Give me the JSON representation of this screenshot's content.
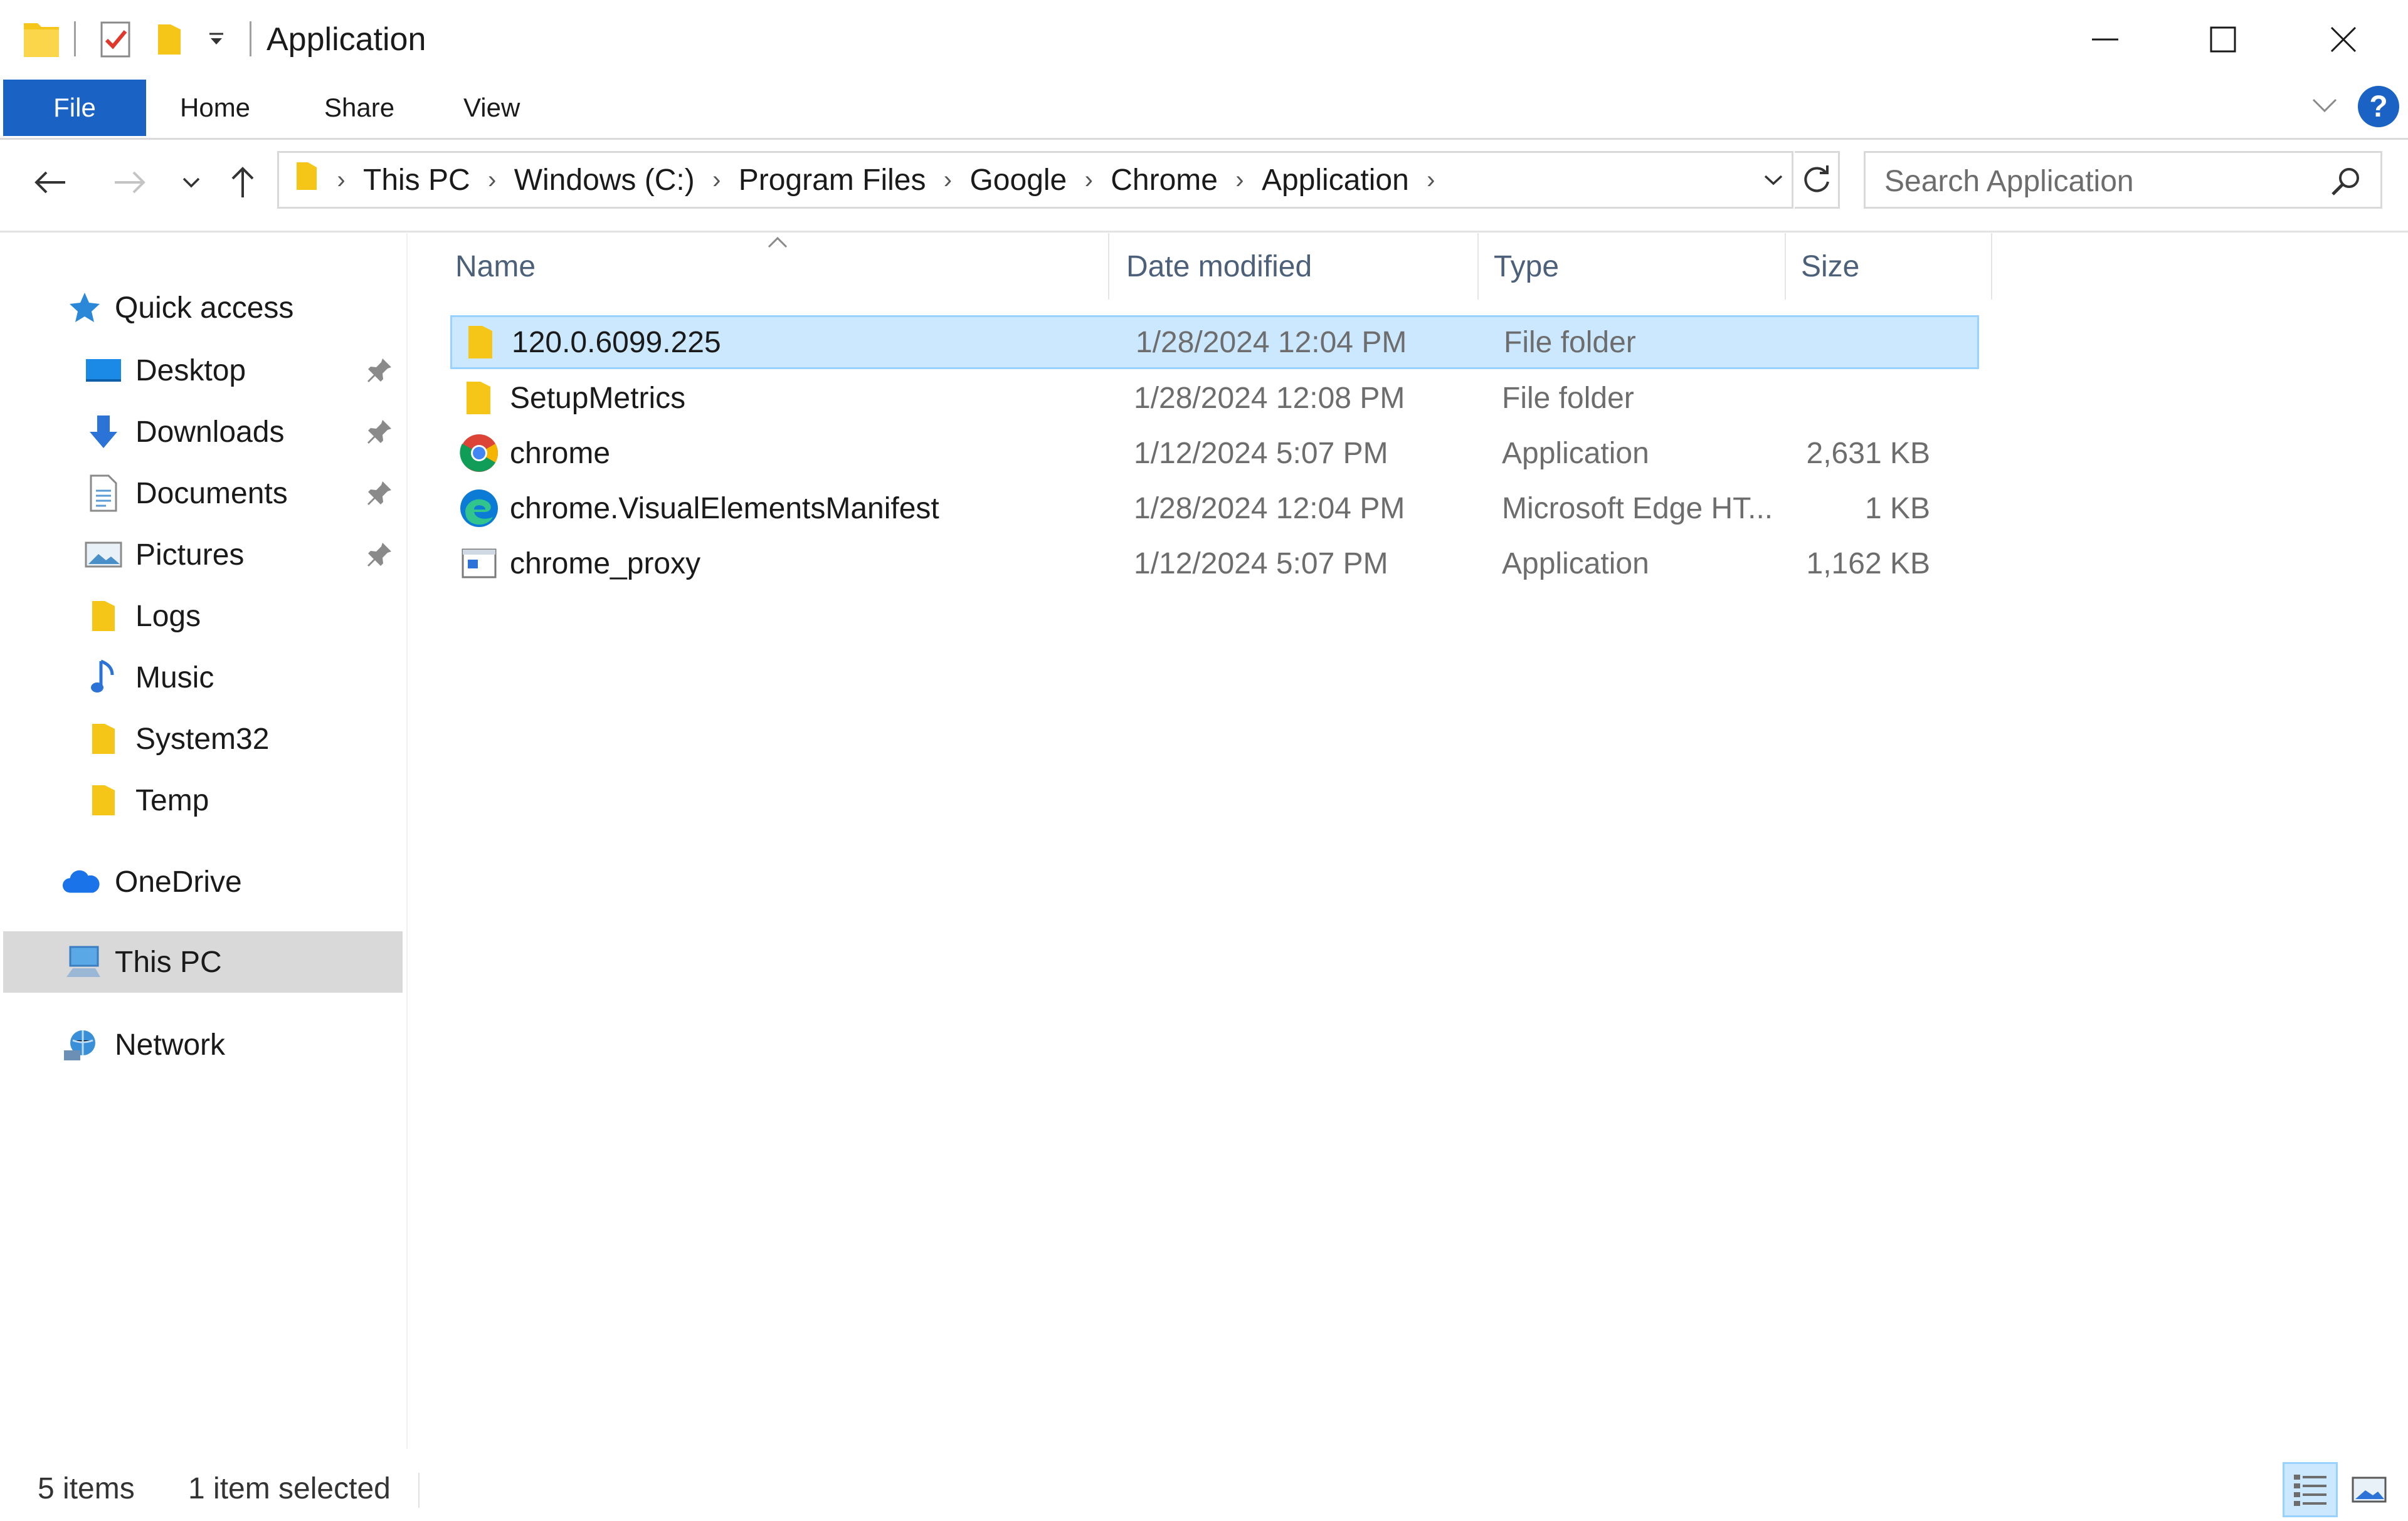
{
  "window": {
    "title": "Application",
    "controls": [
      "minimize",
      "maximize",
      "close"
    ]
  },
  "ribbon": {
    "tabs": [
      "File",
      "Home",
      "Share",
      "View"
    ],
    "help": "?"
  },
  "navigation": {
    "breadcrumb": [
      "This PC",
      "Windows (C:)",
      "Program Files",
      "Google",
      "Chrome",
      "Application"
    ],
    "search_placeholder": "Search Application"
  },
  "sidebar": {
    "quick_access": "Quick access",
    "items": [
      {
        "label": "Desktop",
        "icon": "desktop-icon",
        "pinned": true
      },
      {
        "label": "Downloads",
        "icon": "downloads-icon",
        "pinned": true
      },
      {
        "label": "Documents",
        "icon": "documents-icon",
        "pinned": true
      },
      {
        "label": "Pictures",
        "icon": "pictures-icon",
        "pinned": true
      },
      {
        "label": "Logs",
        "icon": "folder-icon",
        "pinned": false
      },
      {
        "label": "Music",
        "icon": "music-icon",
        "pinned": false
      },
      {
        "label": "System32",
        "icon": "folder-icon",
        "pinned": false
      },
      {
        "label": "Temp",
        "icon": "folder-icon",
        "pinned": false
      }
    ],
    "onedrive": "OneDrive",
    "this_pc": "This PC",
    "network": "Network",
    "selected": "This PC"
  },
  "file_list": {
    "columns": {
      "name": "Name",
      "date": "Date modified",
      "type": "Type",
      "size": "Size"
    },
    "sort_column": "Name",
    "files": [
      {
        "name": "120.0.6099.225",
        "date": "1/28/2024 12:04 PM",
        "type": "File folder",
        "size": "",
        "icon": "folder-icon",
        "selected": true
      },
      {
        "name": "SetupMetrics",
        "date": "1/28/2024 12:08 PM",
        "type": "File folder",
        "size": "",
        "icon": "folder-icon",
        "selected": false
      },
      {
        "name": "chrome",
        "date": "1/12/2024 5:07 PM",
        "type": "Application",
        "size": "2,631 KB",
        "icon": "chrome-icon",
        "selected": false
      },
      {
        "name": "chrome.VisualElementsManifest",
        "date": "1/28/2024 12:04 PM",
        "type": "Microsoft Edge HT...",
        "size": "1 KB",
        "icon": "edge-icon",
        "selected": false
      },
      {
        "name": "chrome_proxy",
        "date": "1/12/2024 5:07 PM",
        "type": "Application",
        "size": "1,162 KB",
        "icon": "application-icon",
        "selected": false
      }
    ]
  },
  "status": {
    "item_count": "5 items",
    "selection": "1 item selected"
  },
  "colors": {
    "accent": "#1a63c4",
    "selection_bg": "#cce8ff",
    "selection_border": "#99d1ff",
    "folder": "#f5c518",
    "column_header_text": "#4c607a",
    "metadata_text": "#6d6d6d"
  }
}
